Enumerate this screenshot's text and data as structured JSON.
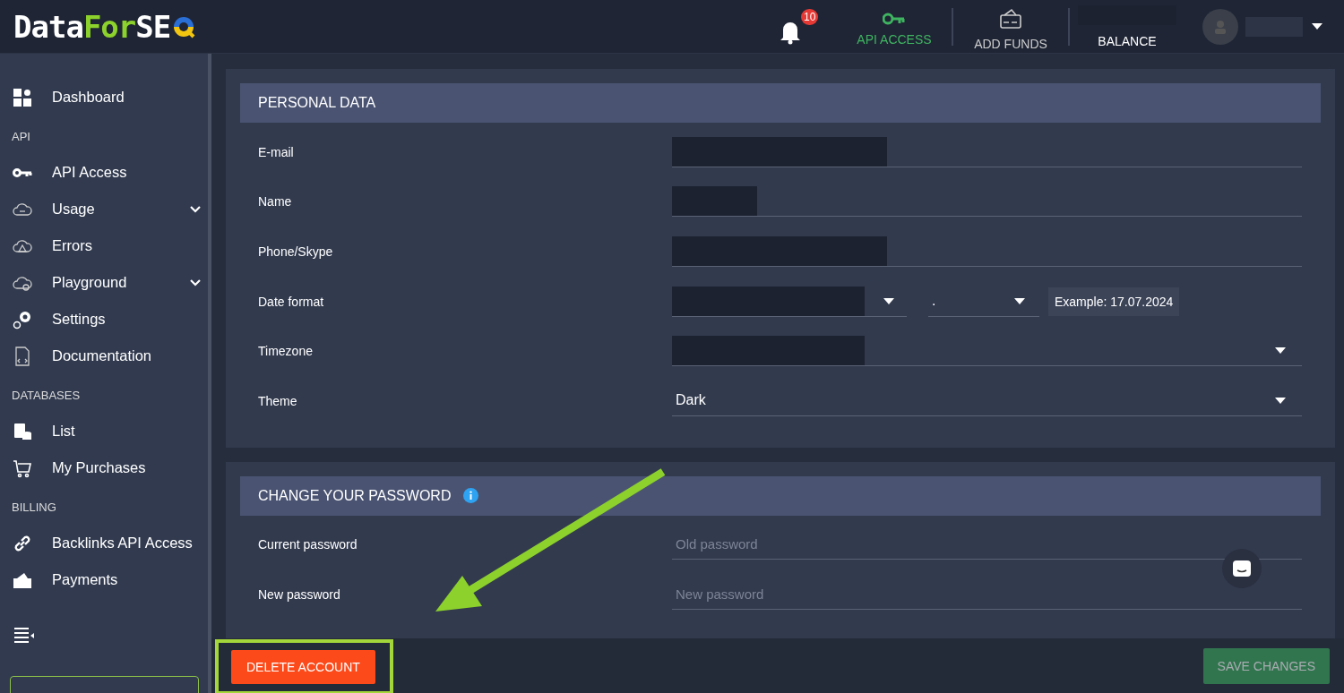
{
  "header": {
    "logo": [
      "Data",
      "For",
      "SE"
    ],
    "notifications": "10",
    "nav": [
      {
        "label": "API ACCESS",
        "selected": true
      },
      {
        "label": "ADD FUNDS",
        "selected": false
      }
    ],
    "balance": {
      "label": "BALANCE"
    }
  },
  "sidebar": {
    "sections": [
      {
        "items": [
          {
            "label": "Dashboard",
            "expandable": false
          }
        ]
      },
      {
        "title": "API",
        "items": [
          {
            "label": "API Access",
            "expandable": false
          },
          {
            "label": "Usage",
            "expandable": true
          },
          {
            "label": "Errors",
            "expandable": false
          },
          {
            "label": "Playground",
            "expandable": true
          },
          {
            "label": "Settings",
            "expandable": false
          },
          {
            "label": "Documentation",
            "expandable": false
          }
        ]
      },
      {
        "title": "DATABASES",
        "items": [
          {
            "label": "List",
            "expandable": false
          },
          {
            "label": "My Purchases",
            "expandable": false
          }
        ]
      },
      {
        "title": "BILLING",
        "items": [
          {
            "label": "Backlinks API Access",
            "expandable": false
          },
          {
            "label": "Payments",
            "expandable": false
          }
        ]
      }
    ]
  },
  "personal_data": {
    "title": "PERSONAL DATA",
    "fields": [
      {
        "label": "E-mail",
        "kind": "masked"
      },
      {
        "label": "Name",
        "kind": "masked"
      },
      {
        "label": "Phone/Skype",
        "kind": "masked"
      },
      {
        "label": "Date format",
        "kind": "date",
        "separator": ".",
        "example": "Example: 17.07.2024"
      },
      {
        "label": "Timezone",
        "kind": "masked-select"
      },
      {
        "label": "Theme",
        "kind": "select",
        "value": "Dark"
      }
    ]
  },
  "change_password": {
    "title": "CHANGE YOUR PASSWORD",
    "fields": [
      {
        "label": "Current password",
        "placeholder": "Old password"
      },
      {
        "label": "New password",
        "placeholder": "New password"
      }
    ]
  },
  "footer": {
    "delete_button": "DELETE ACCOUNT",
    "save_button": "SAVE CHANGES",
    "save_disabled": true
  }
}
